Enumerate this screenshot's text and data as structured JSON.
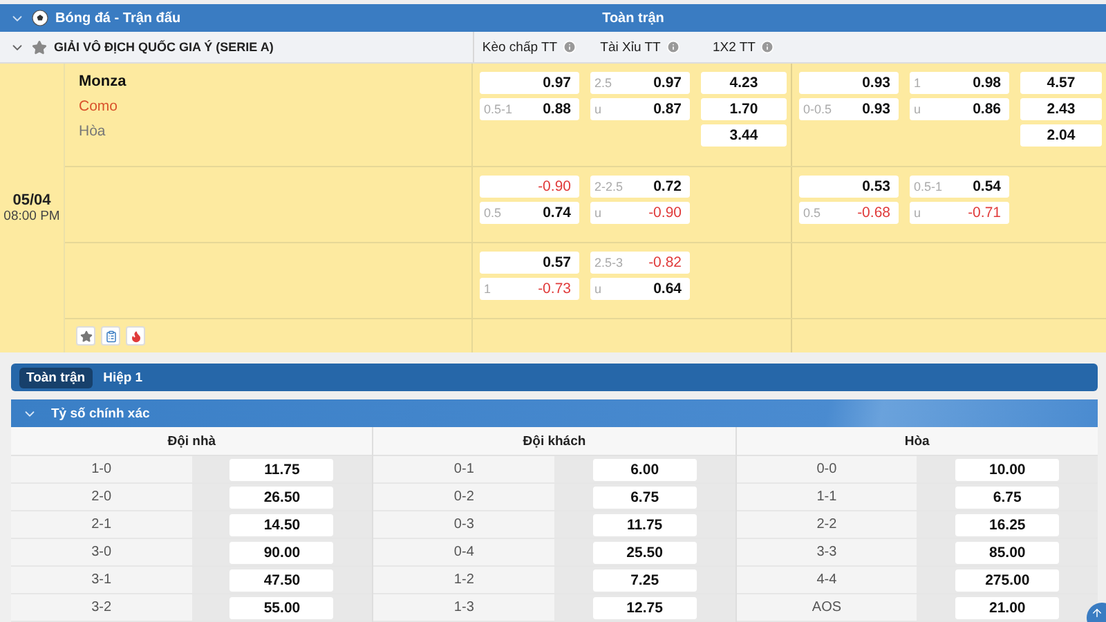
{
  "sport_header": {
    "title": "Bóng đá - Trận đấu",
    "expanded": true,
    "period": "Toàn trận"
  },
  "league": {
    "name": "GIẢI VÔ ĐỊCH QUỐC GIA Ý (SERIE A)",
    "expanded": true,
    "columns": [
      "Kèo chấp TT",
      "Tài Xỉu TT",
      "1X2 TT"
    ]
  },
  "match": {
    "date": "05/04",
    "time": "08:00 PM",
    "home": "Monza",
    "away": "Como",
    "draw": "Hòa",
    "lines": [
      {
        "handicap": [
          {
            "value": "0.97",
            "negative": false
          },
          {
            "line": "0.5-1",
            "value": "0.88",
            "negative": false
          }
        ],
        "total": [
          {
            "line": "2.5",
            "value": "0.97",
            "negative": false
          },
          {
            "line": "u",
            "value": "0.87",
            "negative": false
          }
        ],
        "x12": [
          {
            "value": "4.23",
            "negative": false
          },
          {
            "value": "1.70",
            "negative": false
          },
          {
            "value": "3.44",
            "negative": false
          }
        ],
        "h1_handicap": [
          {
            "value": "0.93",
            "negative": false
          },
          {
            "line": "0-0.5",
            "value": "0.93",
            "negative": false
          }
        ],
        "h1_total": [
          {
            "line": "1",
            "value": "0.98",
            "negative": false
          },
          {
            "line": "u",
            "value": "0.86",
            "negative": false
          }
        ],
        "h1_x12": [
          {
            "value": "4.57",
            "negative": false
          },
          {
            "value": "2.43",
            "negative": false
          },
          {
            "value": "2.04",
            "negative": false
          }
        ]
      },
      {
        "handicap": [
          {
            "value": "-0.90",
            "negative": true
          },
          {
            "line": "0.5",
            "value": "0.74",
            "negative": false
          }
        ],
        "total": [
          {
            "line": "2-2.5",
            "value": "0.72",
            "negative": false
          },
          {
            "line": "u",
            "value": "-0.90",
            "negative": true
          }
        ],
        "h1_handicap": [
          {
            "value": "0.53",
            "negative": false
          },
          {
            "line": "0.5",
            "value": "-0.68",
            "negative": true
          }
        ],
        "h1_total": [
          {
            "line": "0.5-1",
            "value": "0.54",
            "negative": false
          },
          {
            "line": "u",
            "value": "-0.71",
            "negative": true
          }
        ]
      },
      {
        "handicap": [
          {
            "value": "0.57",
            "negative": false
          },
          {
            "line": "1",
            "value": "-0.73",
            "negative": true
          }
        ],
        "total": [
          {
            "line": "2.5-3",
            "value": "-0.82",
            "negative": true
          },
          {
            "line": "u",
            "value": "0.64",
            "negative": false
          }
        ]
      }
    ]
  },
  "tabs": [
    {
      "label": "Toàn trận",
      "selected": true
    },
    {
      "label": "Hiệp 1",
      "selected": false
    }
  ],
  "section": {
    "title": "Tỷ số chính xác",
    "expanded": true
  },
  "groups": [
    {
      "heading": "Đội nhà",
      "rows": [
        {
          "score": "1-0",
          "odds": "11.75"
        },
        {
          "score": "2-0",
          "odds": "26.50"
        },
        {
          "score": "2-1",
          "odds": "14.50"
        },
        {
          "score": "3-0",
          "odds": "90.00"
        },
        {
          "score": "3-1",
          "odds": "47.50"
        },
        {
          "score": "3-2",
          "odds": "55.00"
        }
      ]
    },
    {
      "heading": "Đội khách",
      "rows": [
        {
          "score": "0-1",
          "odds": "6.00"
        },
        {
          "score": "0-2",
          "odds": "6.75"
        },
        {
          "score": "0-3",
          "odds": "11.75"
        },
        {
          "score": "0-4",
          "odds": "25.50"
        },
        {
          "score": "1-2",
          "odds": "7.25"
        },
        {
          "score": "1-3",
          "odds": "12.75"
        }
      ]
    },
    {
      "heading": "Hòa",
      "rows": [
        {
          "score": "0-0",
          "odds": "10.00"
        },
        {
          "score": "1-1",
          "odds": "6.75"
        },
        {
          "score": "2-2",
          "odds": "16.25"
        },
        {
          "score": "3-3",
          "odds": "85.00"
        },
        {
          "score": "4-4",
          "odds": "275.00"
        },
        {
          "score": "AOS",
          "odds": "21.00"
        }
      ]
    }
  ]
}
